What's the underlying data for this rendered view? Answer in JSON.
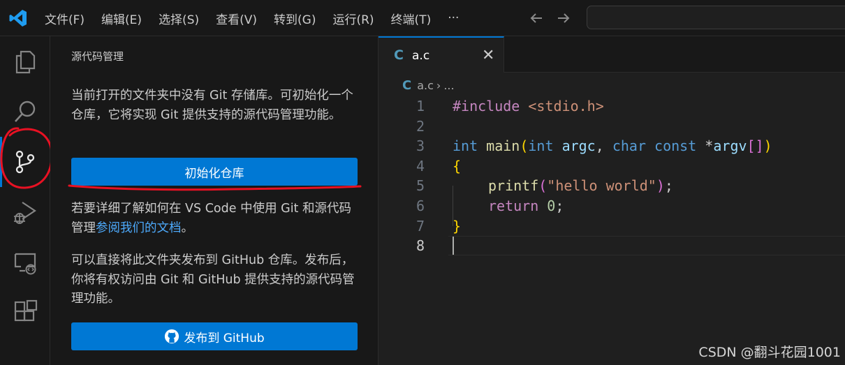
{
  "menubar": {
    "items": [
      "文件(F)",
      "编辑(E)",
      "选择(S)",
      "查看(V)",
      "转到(G)",
      "运行(R)",
      "终端(T)",
      "···"
    ]
  },
  "icons": {
    "logo": "vscode-logo-icon",
    "activity": [
      "explorer-icon",
      "search-icon",
      "source-control-icon",
      "run-debug-icon",
      "remote-explorer-icon",
      "extensions-icon"
    ]
  },
  "colors": {
    "accent": "#0078d4",
    "link": "#4daafc",
    "annotation": "#e81123"
  },
  "sidebar": {
    "title": "源代码管理",
    "intro": "当前打开的文件夹中没有 Git 存储库。可初始化一个仓库，它将实现 Git 提供支持的源代码管理功能。",
    "init_button": "初始化仓库",
    "learn_prefix": "若要详细了解如何在 VS Code 中使用 Git 和源代码管理",
    "learn_link": "参阅我们的文档",
    "learn_suffix": "。",
    "publish_text": "可以直接将此文件夹发布到 GitHub 仓库。发布后，你将有权访问由 Git 和 GitHub 提供支持的源代码管理功能。",
    "publish_button": "发布到 GitHub"
  },
  "editor": {
    "tab_icon": "C",
    "tab_label": "a.c",
    "tab_close": "✕",
    "breadcrumb_icon": "C",
    "breadcrumb_file": "a.c",
    "breadcrumb_sep": "›",
    "breadcrumb_more": "...",
    "line_numbers": [
      "1",
      "2",
      "3",
      "4",
      "5",
      "6",
      "7",
      "8"
    ],
    "code": {
      "l1_pre": "#include",
      "l1_str": "<stdio.h>",
      "l3_type": "int",
      "l3_fn": "main",
      "l3_p1": "int",
      "l3_v1": "argc",
      "l3_p2": "char",
      "l3_p3": "const",
      "l3_v2": "argv",
      "l4": "{",
      "l5_fn": "printf",
      "l5_str": "\"hello world\"",
      "l6_kw": "return",
      "l6_num": "0",
      "l7": "}"
    }
  },
  "watermark": "CSDN @翻斗花园1001"
}
